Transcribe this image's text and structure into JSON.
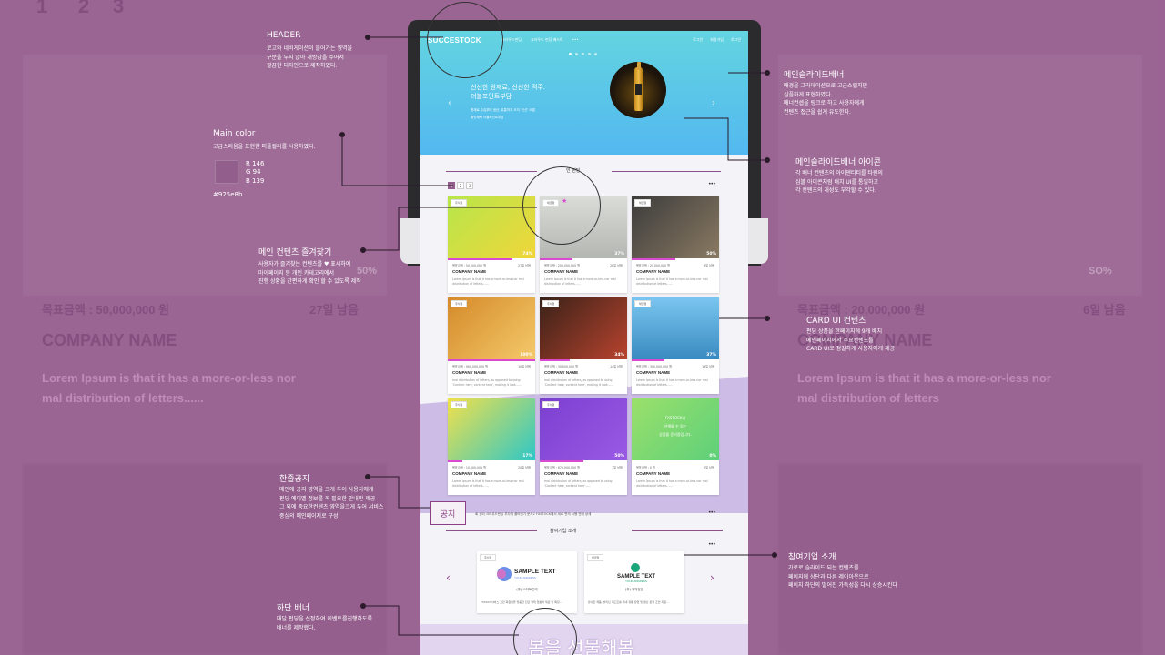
{
  "background": {
    "tabs": [
      "1",
      "2",
      "3"
    ],
    "large_texts": [
      "목표금액 : 50,000,000 원",
      "27일 남음",
      "COMPANY NAME",
      "Lorem Ipsum is that it has a more-or-less nor",
      "mal distribution of letters......",
      "목표금액 : 20,000,000 원",
      "6일 남음",
      "COMPANY NAME",
      "Lorem Ipsum is that it has a more-or-less nor",
      "mal distribution of letters",
      "50%",
      "SO%"
    ]
  },
  "site": {
    "logo": "SUCCESTOCK",
    "nav": [
      "크라우드펀딩",
      "크라우드 펀딩 베스트",
      "•••"
    ],
    "util": [
      "로그인",
      "회원가입",
      "로그인"
    ],
    "hero": {
      "title": "신선한 원재료, 신선한 맥주.\n더블포인트부담",
      "desc": "원재료 수입부터 생산, 유통까지 오직 '신선' 비결\n할인혜택 더블포인트부담"
    },
    "funding_title": "인 펀딩",
    "pages": [
      "1",
      "2",
      "3"
    ],
    "more": "•••",
    "cards": [
      {
        "tag": "주식형",
        "pct": "74%",
        "goal": "목표금액 : 50,000,000 원",
        "days": "27일 남음",
        "name": "COMPANY NAME",
        "desc": "Lorem Ipsum is that it has a more-or-less nor mal distribution of letters......",
        "bar": 0.74
      },
      {
        "tag": "채권형",
        "pct": "37%",
        "goal": "목표금액 : 200,000,000 원",
        "days": "28일 남음",
        "name": "COMPANY NAME",
        "desc": "Lorem Ipsum is that it has a more-or-less nor mal distribution of letters......",
        "bar": 0.37
      },
      {
        "tag": "채권형",
        "pct": "50%",
        "goal": "목표금액 : 20,000,000 원",
        "days": "6일 남음",
        "name": "COMPANY NAME",
        "desc": "Lorem Ipsum is that it has a more-or-less nor mal distribution of letters......",
        "bar": 0.5
      },
      {
        "tag": "주식형",
        "pct": "100%",
        "goal": "목표금액 : 900,000,000 원",
        "days": "10일 남음",
        "name": "COMPANY NAME",
        "desc": "mal distribution of letters, as opposed to using 'Content here, content here', making it look......",
        "bar": 1.0
      },
      {
        "tag": "주식형",
        "pct": "34%",
        "goal": "목표금액 : 30,000,000 원",
        "days": "14일 남음",
        "name": "COMPANY NAME",
        "desc": "mal distribution of letters, as opposed to using 'Content here, content here', making it look......",
        "bar": 0.34
      },
      {
        "tag": "채권형",
        "pct": "37%",
        "goal": "목표금액 : 300,000,000 원",
        "days": "19일 남음",
        "name": "COMPANY NAME",
        "desc": "Lorem Ipsum is that it has a more-or-less nor mal distribution of letters......",
        "bar": 0.37
      },
      {
        "tag": "주식형",
        "pct": "17%",
        "goal": "목표금액 : 10,000,000 원",
        "days": "20일 남음",
        "name": "COMPANY NAME",
        "desc": "Lorem Ipsum is that it has a more-or-less nor mal distribution of letters......",
        "bar": 0.17
      },
      {
        "tag": "주식형",
        "pct": "50%",
        "goal": "목표금액 : 670,000,000 원",
        "days": "1일 남음",
        "name": "COMPANY NAME",
        "desc": "mal distribution of letters, as opposed to using 'Content here, content here'......",
        "bar": 0.5
      },
      {
        "tag": "",
        "pct": "0%",
        "goal": "목표금액 : 0 원",
        "days": "0일 남음",
        "name": "COMPANY NAME",
        "desc": "Lorem Ipsum is that it has a more-or-less nor mal distribution of letters......",
        "bar": 0.0,
        "placeholder": "FXSTOCK가\n선해될 수 있는\n상품을 준비중입니다."
      }
    ],
    "notice_text": "회 권리 크라우드펀딩 투자자 플러인기 문서2 FXSTOCK에서 새로 편의 시행 안내 상세",
    "partner_title": "참여기업 소개",
    "partners": [
      {
        "tag": "주식형",
        "logo": "SAMPLE TEXT",
        "sub": "YOUR ADDRESS",
        "name": "(주) 스타트관리",
        "desc": "FXSTAT 서비스 고민 회원님을 맞춤한 진단 형태 업분석 재료 및 확장..."
      },
      {
        "tag": "채권형",
        "logo": "SAMPLE TEXT",
        "sub": "YOUR ADDRESS",
        "name": "(주) 유익장동",
        "desc": "유사한 제품, 솔리딘 피드트를 국내 유통 창업 및 생산 운영 조언 지원..."
      }
    ],
    "bottom_banner": "봄을 선물해봄"
  },
  "annotations": {
    "header": {
      "title": "HEADER",
      "body": "로고와 네비게이션이 들어가는 영역을\n구분을 두지 않아 개방감을 주어서\n깔끔한 디자인으로 제작하였다."
    },
    "main_color": {
      "title": "Main color",
      "body": "고급스러움을 표현한 퍼플컬러를 사용하였다.",
      "rgb": "R 146\nG 94\nB 139",
      "hex": "#925e8b",
      "swatch": "#925e8b"
    },
    "favorites": {
      "title": "메인 컨텐츠 즐겨찾기",
      "body": "사용자가 즐겨찾는 컨텐츠를 ♥ 표시하여\n마이페이지 등 개인 카테고리에서\n진행 상황을 간편하게 확인 할 수 있도록 제작"
    },
    "notice": {
      "title": "한줄공지",
      "body": "메인에 공지 영역을 크게 두어 사용자에게\n펀딩 예이벨 정보를 꼭 필요한 안내만 제공\n그 외에 중요한컨텐츠 영역을크게 두어 서비스\n중심의 메인페이지로 구성",
      "badge": "공지"
    },
    "bottom": {
      "title": "하단 배너",
      "body": "매달 펀딩을 선정하여 이벤트를진행하도록\n배너를 제작했다."
    },
    "slide": {
      "title": "메인슬라이드배너",
      "body": "배경을 그라데이션으로 고급스럽지만\n심플하게 표현하였다.\n배너컨셉을 링크로 하고 사용자에게\n컨텐츠 접근을 쉽게 유도한다."
    },
    "slide_icon": {
      "title": "메인슬라이드배너 아이콘",
      "body": "각 배너 컨텐츠의 아이덴티티를 타원의\n심볼 아이콘처럼 배치 UI를 통일하고\n각 컨텐츠의 개성도 부각할 수 있다."
    },
    "card_ui": {
      "title": "CARD UI 컨텐츠",
      "body": "펀딩 상품을 한페이지에 9개 배치\n메인페이지에서 주요컨텐츠를\nCARD UI로 정갈하게 사용자에게 제공"
    },
    "partners": {
      "title": "참여기업 소개",
      "body": "가로로 슬라이드 되는 컨텐츠를\n페이지에 상단과 다른 레이아웃으로\n페이지 하단의 떨어진 가독성을 다시 상승시킨다"
    }
  },
  "colors": {
    "main": "#925e8b",
    "accent": "#d94ad1",
    "hero_top": "#63d4e0",
    "hero_bottom": "#53b8f0"
  }
}
